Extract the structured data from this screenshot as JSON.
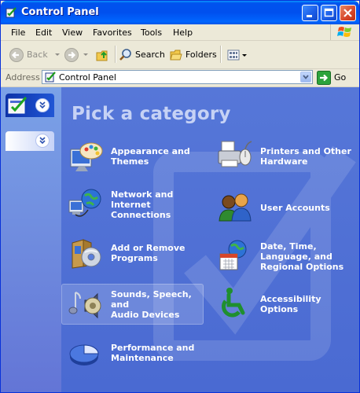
{
  "window": {
    "title": "Control Panel"
  },
  "menubar": {
    "items": [
      "File",
      "Edit",
      "View",
      "Favorites",
      "Tools",
      "Help"
    ]
  },
  "toolbar": {
    "back_label": "Back",
    "search_label": "Search",
    "folders_label": "Folders"
  },
  "address": {
    "label": "Address",
    "value": "Control Panel",
    "go_label": "Go"
  },
  "main": {
    "heading": "Pick a category",
    "categories": [
      {
        "label": "Appearance and\nThemes",
        "icon": "appearance-themes-icon"
      },
      {
        "label": "Printers and Other\nHardware",
        "icon": "printer-icon"
      },
      {
        "label": "Network and\nInternet Connections",
        "icon": "network-globe-icon"
      },
      {
        "label": "User Accounts",
        "icon": "user-accounts-icon"
      },
      {
        "label": "Add or Remove\nPrograms",
        "icon": "add-remove-programs-icon"
      },
      {
        "label": "Date, Time,\nLanguage, and\nRegional Options",
        "icon": "calendar-globe-icon"
      },
      {
        "label": "Sounds, Speech, and\nAudio Devices",
        "icon": "speaker-note-icon",
        "selected": true
      },
      {
        "label": "Accessibility Options",
        "icon": "wheelchair-icon"
      },
      {
        "label": "Performance and\nMaintenance",
        "icon": "pie-chart-icon"
      }
    ]
  },
  "colors": {
    "title_bar": "#0055e5",
    "panel_bg": "#5a7edc",
    "heading": "#c6d2f5",
    "chrome": "#ece9d8"
  }
}
